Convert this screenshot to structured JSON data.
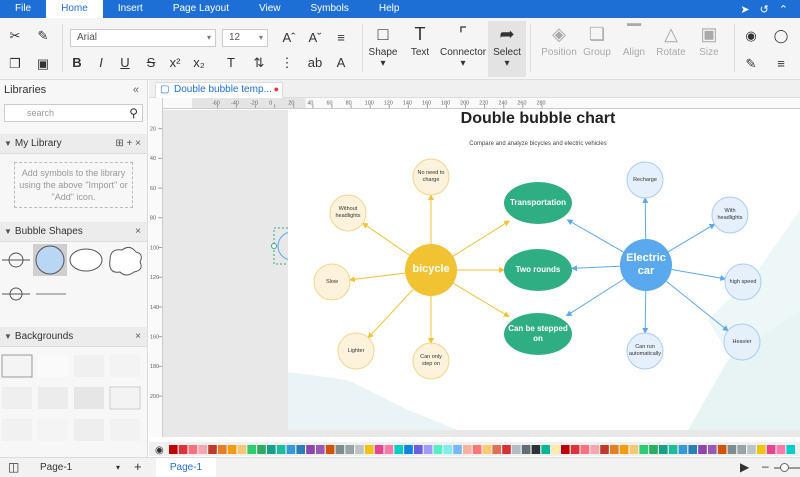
{
  "menubar": {
    "items": [
      "File",
      "Home",
      "Insert",
      "Page Layout",
      "View",
      "Symbols",
      "Help"
    ],
    "active": "Home"
  },
  "ribbon": {
    "font_name": "Arial",
    "font_size": "12",
    "buttons": {
      "shape": "Shape",
      "text": "Text",
      "connector": "Connector",
      "select": "Select",
      "position": "Position",
      "group": "Group",
      "align": "Align",
      "rotate": "Rotate",
      "size": "Size"
    }
  },
  "left_panel": {
    "title": "Libraries",
    "search_placeholder": "search",
    "my_library": "My Library",
    "my_library_hint": "Add symbols to the library using the above \"Import\" or \"Add\" icon.",
    "bubble_shapes": "Bubble Shapes",
    "backgrounds": "Backgrounds"
  },
  "doc_tab": {
    "label": "Double bubble temp..."
  },
  "ruler": {
    "h_ticks": [
      "-60",
      "-40",
      "-20",
      "0",
      "20",
      "40",
      "60",
      "80",
      "100",
      "120",
      "140",
      "160",
      "180",
      "200",
      "220",
      "240",
      "260",
      "280"
    ],
    "v_ticks": [
      "20",
      "40",
      "60",
      "80",
      "100",
      "120",
      "140",
      "160",
      "180",
      "200"
    ]
  },
  "diagram": {
    "title": "Double bubble chart",
    "subtitle": "Compare and analyze bicycles and electric vehicles",
    "left_center": "bicycle",
    "right_center": "Electric car",
    "shared": [
      "Transportation",
      "Two rounds",
      "Can be stepped on"
    ],
    "left_items": [
      "No need to charge",
      "Without headlights",
      "Slow",
      "Lighter",
      "Can only step on"
    ],
    "right_items": [
      "Recharge",
      "With headlights",
      "high speed",
      "Heavier",
      "Can run automatically"
    ],
    "colors": {
      "left": "#f1c232",
      "left_light": "#fdf3dc",
      "shared": "#2fae83",
      "right": "#5aa9ef",
      "right_light": "#e6f0fc"
    }
  },
  "status": {
    "page_selector": "Page-1",
    "active_page": "Page-1"
  }
}
